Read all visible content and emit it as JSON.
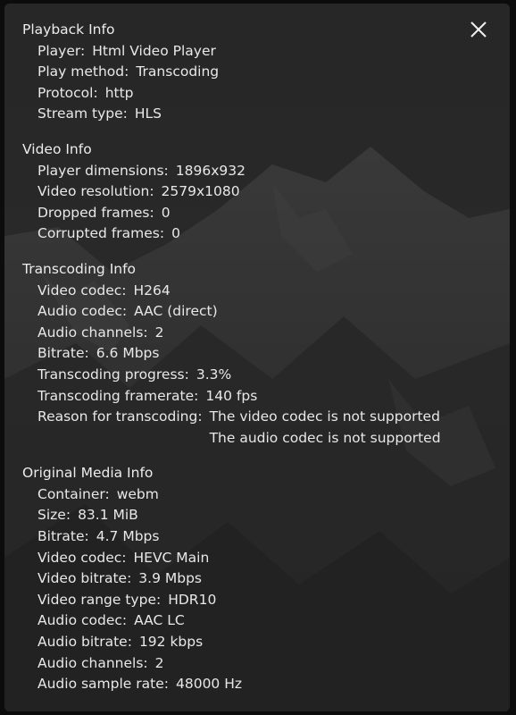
{
  "dialog": {
    "close_icon": "close-icon",
    "sections": [
      {
        "title": "Playback Info",
        "rows": [
          {
            "label": "Player",
            "values": [
              "Html Video Player"
            ]
          },
          {
            "label": "Play method",
            "values": [
              "Transcoding"
            ]
          },
          {
            "label": "Protocol",
            "values": [
              "http"
            ]
          },
          {
            "label": "Stream type",
            "values": [
              "HLS"
            ]
          }
        ]
      },
      {
        "title": "Video Info",
        "rows": [
          {
            "label": "Player dimensions",
            "values": [
              "1896x932"
            ]
          },
          {
            "label": "Video resolution",
            "values": [
              "2579x1080"
            ]
          },
          {
            "label": "Dropped frames",
            "values": [
              "0"
            ]
          },
          {
            "label": "Corrupted frames",
            "values": [
              "0"
            ]
          }
        ]
      },
      {
        "title": "Transcoding Info",
        "rows": [
          {
            "label": "Video codec",
            "values": [
              "H264"
            ]
          },
          {
            "label": "Audio codec",
            "values": [
              "AAC (direct)"
            ]
          },
          {
            "label": "Audio channels",
            "values": [
              "2"
            ]
          },
          {
            "label": "Bitrate",
            "values": [
              "6.6 Mbps"
            ]
          },
          {
            "label": "Transcoding progress",
            "values": [
              "3.3%"
            ]
          },
          {
            "label": "Transcoding framerate",
            "values": [
              "140 fps"
            ]
          },
          {
            "label": "Reason for transcoding",
            "values": [
              "The video codec is not supported",
              "The audio codec is not supported"
            ]
          }
        ]
      },
      {
        "title": "Original Media Info",
        "rows": [
          {
            "label": "Container",
            "values": [
              "webm"
            ]
          },
          {
            "label": "Size",
            "values": [
              "83.1 MiB"
            ]
          },
          {
            "label": "Bitrate",
            "values": [
              "4.7 Mbps"
            ]
          },
          {
            "label": "Video codec",
            "values": [
              "HEVC Main"
            ]
          },
          {
            "label": "Video bitrate",
            "values": [
              "3.9 Mbps"
            ]
          },
          {
            "label": "Video range type",
            "values": [
              "HDR10"
            ]
          },
          {
            "label": "Audio codec",
            "values": [
              "AAC LC"
            ]
          },
          {
            "label": "Audio bitrate",
            "values": [
              "192 kbps"
            ]
          },
          {
            "label": "Audio channels",
            "values": [
              "2"
            ]
          },
          {
            "label": "Audio sample rate",
            "values": [
              "48000 Hz"
            ]
          }
        ]
      }
    ]
  }
}
